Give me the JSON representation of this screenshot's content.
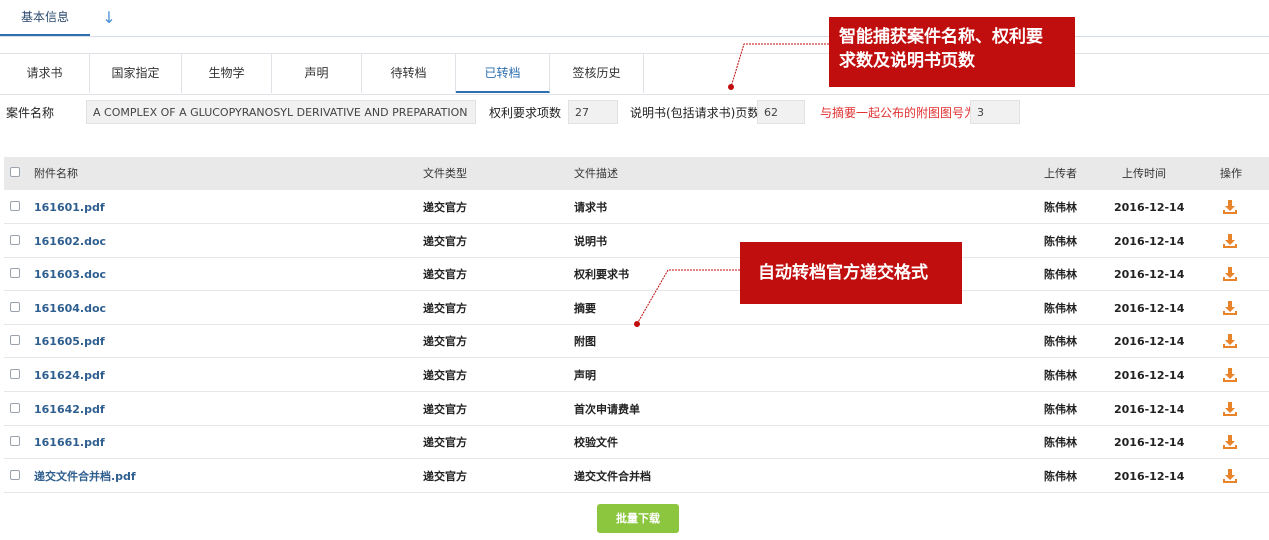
{
  "top_tabs": {
    "active_label": "基本信息",
    "download_arrow_icon": "arrow-down-icon"
  },
  "sub_tabs": [
    {
      "label": "请求书"
    },
    {
      "label": "国家指定"
    },
    {
      "label": "生物学"
    },
    {
      "label": "声明"
    },
    {
      "label": "待转档"
    },
    {
      "label": "已转档",
      "active": true
    },
    {
      "label": "签核历史"
    }
  ],
  "case_info": {
    "case_name_label": "案件名称",
    "case_name_value": "A COMPLEX OF A GLUCOPYRANOSYL DERIVATIVE AND PREPARATION",
    "claims_label": "权利要求项数",
    "claims_value": "27",
    "pages_label": "说明书(包括请求书)页数",
    "pages_value": "62",
    "figure_label": "与摘要一起公布的附图图号为",
    "figure_value": "3"
  },
  "table": {
    "headers": {
      "name": "附件名称",
      "type": "文件类型",
      "desc": "文件描述",
      "uploader": "上传者",
      "time": "上传时间",
      "action": "操作"
    },
    "rows": [
      {
        "name": "161601.pdf",
        "type": "递交官方",
        "desc": "请求书",
        "uploader": "陈伟林",
        "time": "2016-12-14"
      },
      {
        "name": "161602.doc",
        "type": "递交官方",
        "desc": "说明书",
        "uploader": "陈伟林",
        "time": "2016-12-14"
      },
      {
        "name": "161603.doc",
        "type": "递交官方",
        "desc": "权利要求书",
        "uploader": "陈伟林",
        "time": "2016-12-14"
      },
      {
        "name": "161604.doc",
        "type": "递交官方",
        "desc": "摘要",
        "uploader": "陈伟林",
        "time": "2016-12-14"
      },
      {
        "name": "161605.pdf",
        "type": "递交官方",
        "desc": "附图",
        "uploader": "陈伟林",
        "time": "2016-12-14"
      },
      {
        "name": "161624.pdf",
        "type": "递交官方",
        "desc": "声明",
        "uploader": "陈伟林",
        "time": "2016-12-14"
      },
      {
        "name": "161642.pdf",
        "type": "递交官方",
        "desc": "首次申请费单",
        "uploader": "陈伟林",
        "time": "2016-12-14"
      },
      {
        "name": "161661.pdf",
        "type": "递交官方",
        "desc": "校验文件",
        "uploader": "陈伟林",
        "time": "2016-12-14"
      },
      {
        "name": "递交文件合并档.pdf",
        "type": "递交官方",
        "desc": "递交文件合并档",
        "uploader": "陈伟林",
        "time": "2016-12-14"
      }
    ]
  },
  "batch_download_label": "批量下载",
  "callouts": {
    "capture_text_line1": "智能捕获案件名称、权利要",
    "capture_text_line2": "求数及说明书页数",
    "auto_convert_text": "自动转档官方递交格式"
  },
  "colors": {
    "accent": "#2e6fb0",
    "callout": "#c00d0d",
    "batch_button": "#8cc63f",
    "download_icon": "#e8832a",
    "required_label": "#e03030"
  }
}
